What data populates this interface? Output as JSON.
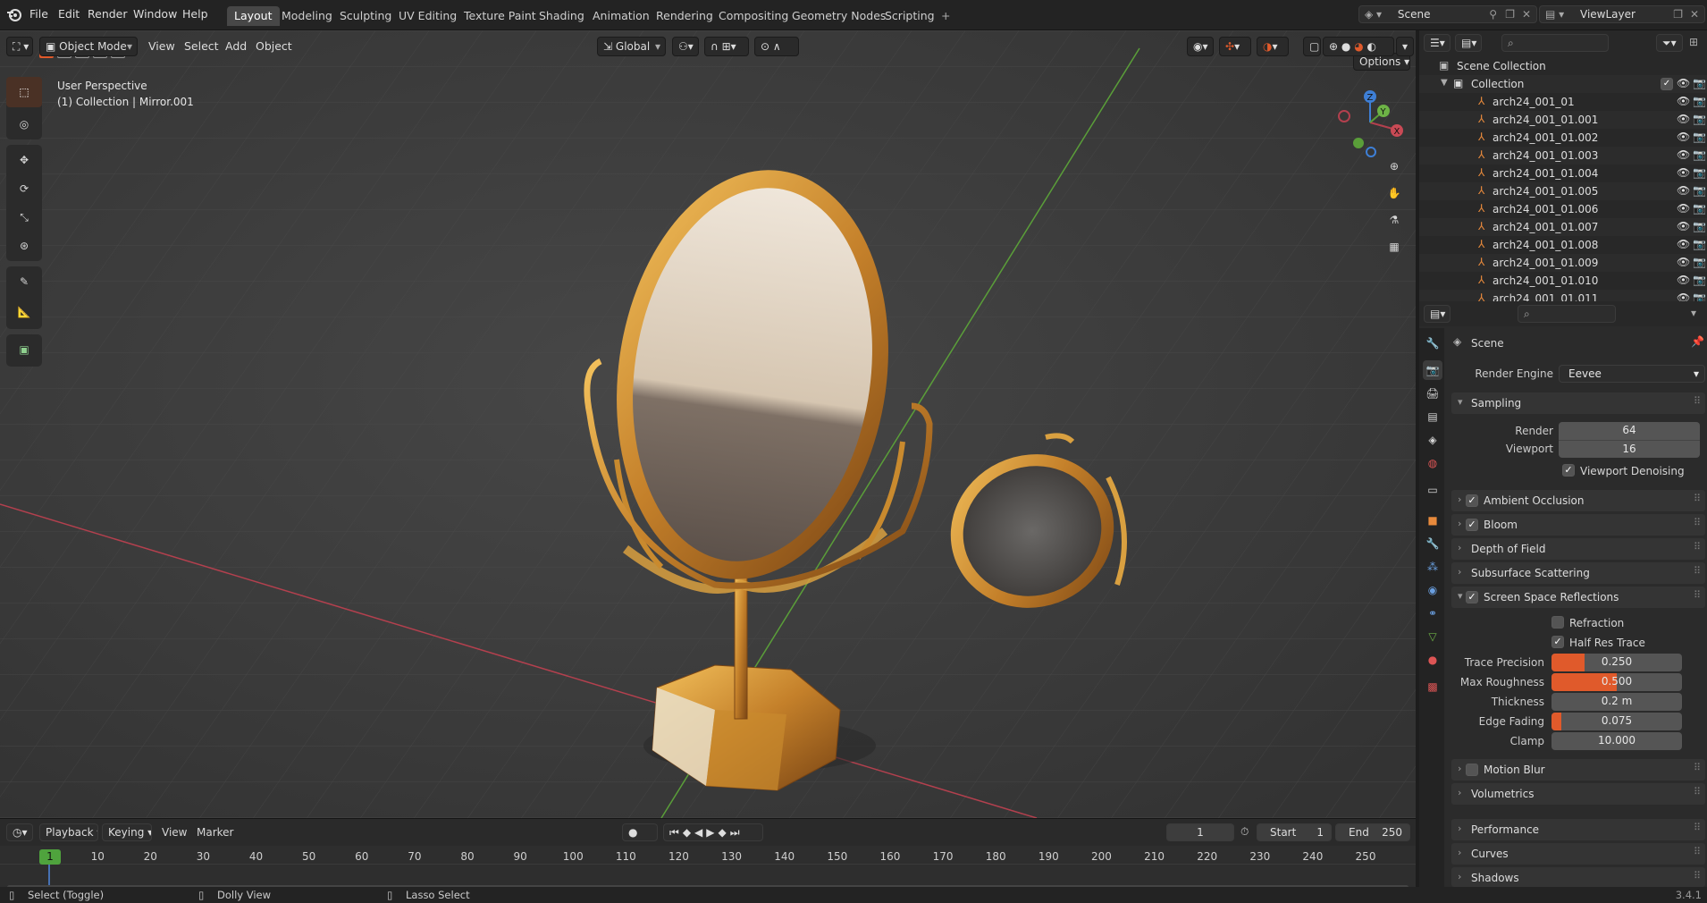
{
  "menu": {
    "file": "File",
    "edit": "Edit",
    "render": "Render",
    "window": "Window",
    "help": "Help"
  },
  "workspaces": [
    "Layout",
    "Modeling",
    "Sculpting",
    "UV Editing",
    "Texture Paint",
    "Shading",
    "Animation",
    "Rendering",
    "Compositing",
    "Geometry Nodes",
    "Scripting"
  ],
  "active_workspace": "Layout",
  "scene_name": "Scene",
  "view_layer": "ViewLayer",
  "viewport": {
    "mode": "Object Mode",
    "menus": {
      "view": "View",
      "select": "Select",
      "add": "Add",
      "object": "Object"
    },
    "transform_orientation": "Global",
    "options_label": "Options",
    "info_line1": "User Perspective",
    "info_line2": "(1) Collection | Mirror.001"
  },
  "outliner": {
    "root": "Scene Collection",
    "collection": "Collection",
    "items": [
      "arch24_001_01",
      "arch24_001_01.001",
      "arch24_001_01.002",
      "arch24_001_01.003",
      "arch24_001_01.004",
      "arch24_001_01.005",
      "arch24_001_01.006",
      "arch24_001_01.007",
      "arch24_001_01.008",
      "arch24_001_01.009",
      "arch24_001_01.010",
      "arch24_001_01.011"
    ]
  },
  "properties": {
    "context": "Scene",
    "render_engine_label": "Render Engine",
    "render_engine": "Eevee",
    "sampling": {
      "title": "Sampling",
      "render_label": "Render",
      "render": "64",
      "viewport_label": "Viewport",
      "viewport": "16",
      "denoise_label": "Viewport Denoising"
    },
    "panels": {
      "ambient_occlusion": "Ambient Occlusion",
      "bloom": "Bloom",
      "depth_of_field": "Depth of Field",
      "subsurface": "Subsurface Scattering",
      "ssr": "Screen Space Reflections",
      "motion_blur": "Motion Blur",
      "volumetrics": "Volumetrics",
      "performance": "Performance",
      "curves": "Curves",
      "shadows": "Shadows"
    },
    "ssr": {
      "refraction_label": "Refraction",
      "half_res_label": "Half Res Trace",
      "trace_precision_label": "Trace Precision",
      "trace_precision": "0.250",
      "trace_precision_fill": 0.25,
      "max_roughness_label": "Max Roughness",
      "max_roughness": "0.500",
      "max_roughness_fill": 0.5,
      "thickness_label": "Thickness",
      "thickness": "0.2 m",
      "edge_fading_label": "Edge Fading",
      "edge_fading": "0.075",
      "edge_fading_fill": 0.075,
      "clamp_label": "Clamp",
      "clamp": "10.000"
    }
  },
  "timeline": {
    "playback": "Playback",
    "keying": "Keying",
    "view": "View",
    "marker": "Marker",
    "current_frame": "1",
    "start_label": "Start",
    "start": "1",
    "end_label": "End",
    "end": "250",
    "ticks": [
      "1",
      "10",
      "20",
      "30",
      "40",
      "50",
      "60",
      "70",
      "80",
      "90",
      "100",
      "110",
      "120",
      "130",
      "140",
      "150",
      "160",
      "170",
      "180",
      "190",
      "200",
      "210",
      "220",
      "230",
      "240",
      "250"
    ]
  },
  "status": {
    "select": "Select (Toggle)",
    "dolly": "Dolly View",
    "lasso": "Lasso Select",
    "version": "3.4.1"
  },
  "colors": {
    "accent": "#e05a2b",
    "active_blue": "#4772b3",
    "x_axis": "#b3404e",
    "y_axis": "#5a9e39",
    "z_axis": "#3e7fd6",
    "gold": "#c98a2e"
  }
}
